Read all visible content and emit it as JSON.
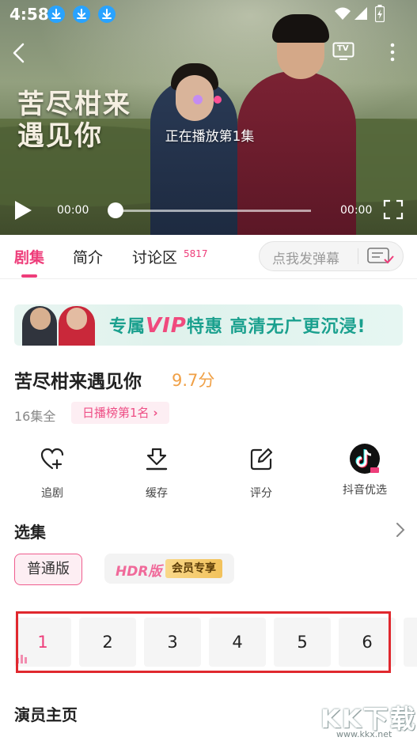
{
  "status_bar": {
    "time": "4:58",
    "icons": [
      "download-icon",
      "download-icon",
      "download-icon",
      "wifi-icon",
      "signal-icon",
      "battery-charging-icon"
    ]
  },
  "player": {
    "title_art": "苦尽柑来\n遇见你",
    "tv_label": "TV",
    "playing_text": "正在播放第1集",
    "current_time": "00:00",
    "total_time": "00:00",
    "progress": 0
  },
  "tabs": [
    {
      "label": "剧集",
      "active": true
    },
    {
      "label": "简介",
      "active": false
    },
    {
      "label": "讨论区",
      "active": false,
      "count": "5817"
    }
  ],
  "danmu": {
    "placeholder": "点我发弹幕"
  },
  "banner": {
    "prefix": "专属",
    "vip": "VIP",
    "text": "特惠 高清无广更沉浸!"
  },
  "drama": {
    "title": "苦尽柑来遇见你",
    "score": "9.7分",
    "episode_count": "16集全",
    "rank": "日播榜第1名"
  },
  "actions": [
    {
      "label": "追剧",
      "icon": "heart-plus-icon"
    },
    {
      "label": "缓存",
      "icon": "download-tray-icon"
    },
    {
      "label": "评分",
      "icon": "edit-icon"
    },
    {
      "label": "抖音优选",
      "icon": "douyin-icon"
    }
  ],
  "episodes_section": {
    "title": "选集",
    "versions": {
      "normal": "普通版",
      "hdr": "HDR版",
      "hdr_badge": "会员专享"
    },
    "episodes": [
      "1",
      "2",
      "3",
      "4",
      "5",
      "6"
    ],
    "active_episode": "1"
  },
  "cast_section": {
    "title": "演员主页"
  },
  "watermark": {
    "main": "KK下载",
    "url": "www.kkx.net"
  },
  "colors": {
    "accent": "#ee3d7a",
    "score": "#f0a046",
    "banner_text": "#1aa08e",
    "highlight_box": "#e0282e"
  }
}
